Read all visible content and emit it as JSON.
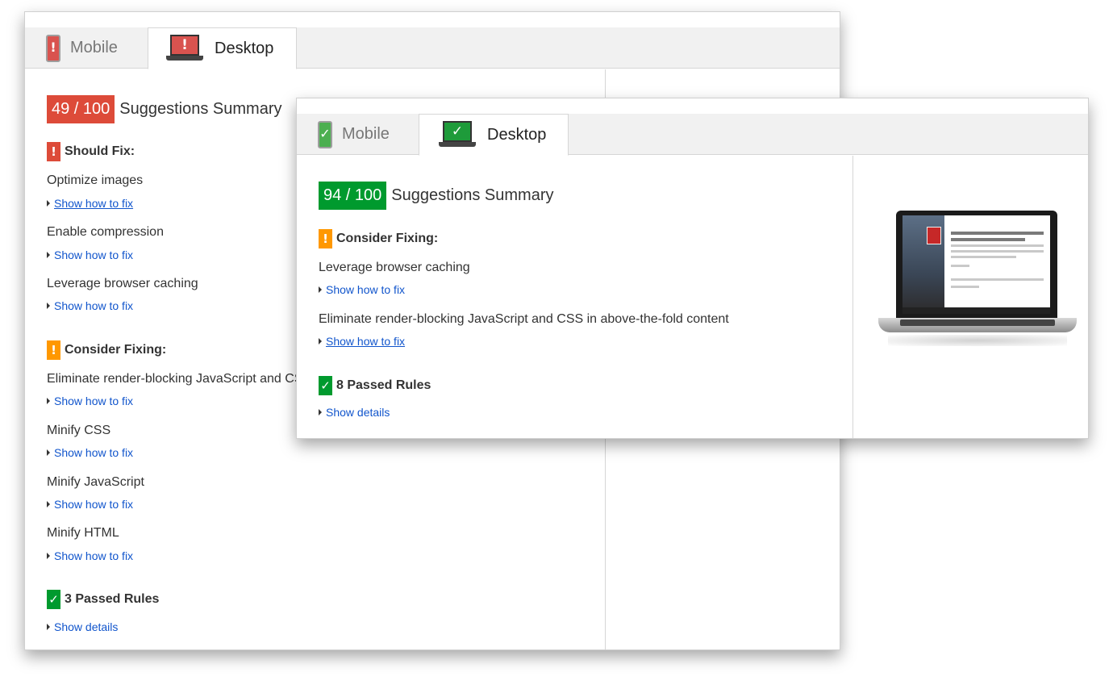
{
  "back_panel": {
    "tabs": {
      "mobile": "Mobile",
      "desktop": "Desktop"
    },
    "score": "49 / 100",
    "summary_title": "Suggestions Summary",
    "should_fix": {
      "icon": "!",
      "heading": "Should Fix:",
      "rules": [
        {
          "name": "Optimize images",
          "link": "Show how to fix"
        },
        {
          "name": "Enable compression",
          "link": "Show how to fix"
        },
        {
          "name": "Leverage browser caching",
          "link": "Show how to fix"
        }
      ]
    },
    "consider_fixing": {
      "icon": "!",
      "heading": "Consider Fixing:",
      "rules": [
        {
          "name": "Eliminate render-blocking JavaScript and CSS in above-the-fold content",
          "link": "Show how to fix"
        },
        {
          "name": "Minify CSS",
          "link": "Show how to fix"
        },
        {
          "name": "Minify JavaScript",
          "link": "Show how to fix"
        },
        {
          "name": "Minify HTML",
          "link": "Show how to fix"
        }
      ]
    },
    "passed": {
      "icon": "✓",
      "heading": "3 Passed Rules",
      "link": "Show details"
    }
  },
  "front_panel": {
    "tabs": {
      "mobile": "Mobile",
      "desktop": "Desktop"
    },
    "score": "94 / 100",
    "summary_title": "Suggestions Summary",
    "consider_fixing": {
      "icon": "!",
      "heading": "Consider Fixing:",
      "rules": [
        {
          "name": "Leverage browser caching",
          "link": "Show how to fix"
        },
        {
          "name": "Eliminate render-blocking JavaScript and CSS in above-the-fold content",
          "link": "Show how to fix"
        }
      ]
    },
    "passed": {
      "icon": "✓",
      "heading": "8 Passed Rules",
      "link": "Show details"
    }
  },
  "glyphs": {
    "warning": "!",
    "check": "✓"
  },
  "colors": {
    "score_red": "#dd4b39",
    "score_green": "#009a2e",
    "warning_orange": "#ff9800",
    "link_blue": "#1155cc"
  }
}
